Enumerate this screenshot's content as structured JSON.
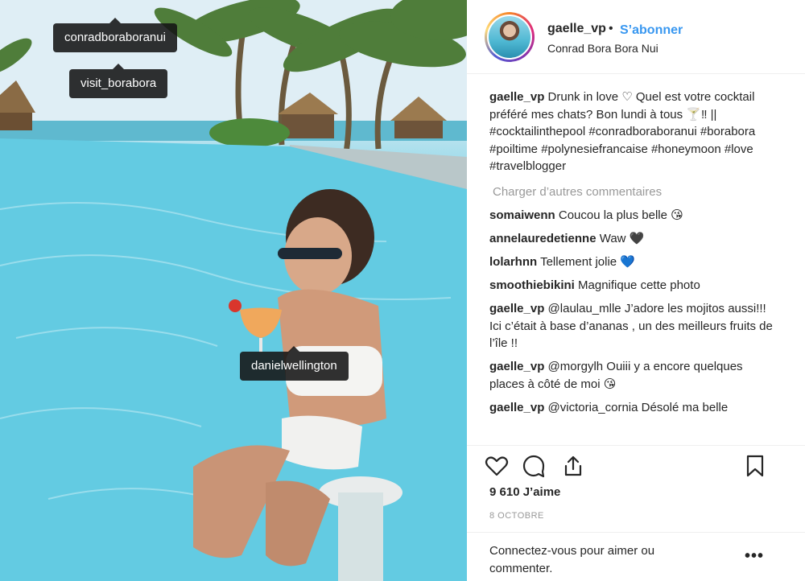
{
  "photo": {
    "tags": [
      "conradboraboranui",
      "visit_borabora",
      "danielwellington"
    ]
  },
  "header": {
    "username": "gaelle_vp",
    "separator": "•",
    "follow_label": "S’abonner",
    "location": "Conrad Bora Bora Nui"
  },
  "caption": {
    "username": "gaelle_vp",
    "text": "Drunk in love ♡ Quel est votre cocktail préféré mes chats? Bon lundi à tous 🍸‼ || #cocktailinthepool #conradboraboranui #borabora #poiltime #polynesiefrancaise #honeymoon #love #travelblogger"
  },
  "load_more": "Charger d’autres commentaires",
  "comments": [
    {
      "username": "somaiwenn",
      "text": "Coucou la plus belle 😘"
    },
    {
      "username": "annelauredetienne",
      "text": "Waw 🖤"
    },
    {
      "username": "lolarhnn",
      "text": "Tellement jolie 💙"
    },
    {
      "username": "smoothiebikini",
      "text": "Magnifique cette photo"
    },
    {
      "username": "gaelle_vp",
      "text": "@laulau_mlle J’adore les mojitos aussi!!! Ici c’était à base d’ananas , un des meilleurs fruits de l’île !!"
    },
    {
      "username": "gaelle_vp",
      "text": "@morgylh Ouiii y a encore quelques places à côté de moi 😘"
    },
    {
      "username": "gaelle_vp",
      "text": "@victoria_cornia Désolé ma belle"
    }
  ],
  "actions": {
    "icons": [
      "heart-icon",
      "comment-icon",
      "share-icon",
      "bookmark-icon"
    ]
  },
  "likes": "9 610 J’aime",
  "date": "8 OCTOBRE",
  "footer": {
    "login_prompt": "Connectez-vous pour aimer ou commenter.",
    "more": "•••"
  }
}
